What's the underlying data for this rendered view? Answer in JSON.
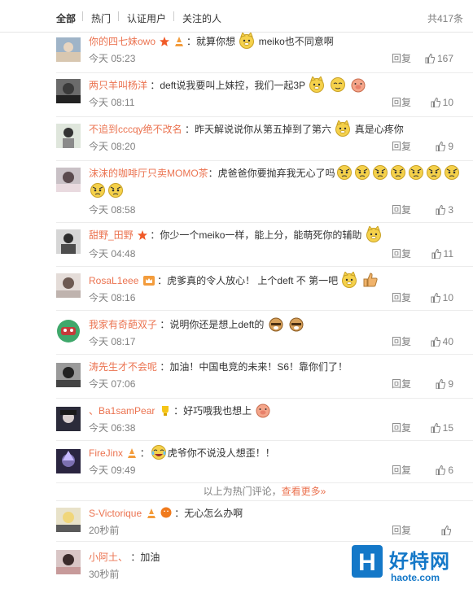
{
  "tabs": [
    {
      "label": "全部",
      "active": true
    },
    {
      "label": "热门",
      "active": false
    },
    {
      "label": "认证用户",
      "active": false
    },
    {
      "label": "关注的人",
      "active": false
    }
  ],
  "total": "共417条",
  "comments": [
    {
      "user": "你的四七妹owo",
      "text_a": "：就算你想",
      "text_b": "meiko也不同意啊",
      "time": "今天 05:23",
      "reply": "回复",
      "likes": "167"
    },
    {
      "user": "两只羊叫杨洋",
      "text_a": "：deft说我要叫上妹控，我们一起3P",
      "text_b": "",
      "time": "今天 08:11",
      "reply": "回复",
      "likes": "10"
    },
    {
      "user": "不追到cccqy绝不改名",
      "text_a": "：昨天解说说你从第五掉到了第六",
      "text_b": "真是心疼你",
      "time": "今天 08:20",
      "reply": "回复",
      "likes": "9"
    },
    {
      "user": "沫沫的咖啡厅只卖MOMO茶",
      "text_a": "：虎爸爸你要抛弃我无心了吗",
      "text_b": "",
      "time": "今天 08:58",
      "reply": "回复",
      "likes": "3"
    },
    {
      "user": "甜野_田野",
      "text_a": "：你少一个meiko一样，能上分，能萌死你的辅助",
      "text_b": "",
      "time": "今天 04:48",
      "reply": "回复",
      "likes": "11"
    },
    {
      "user": "RosaL1eee",
      "text_a": "：虎爹真的令人放心！ 上个deft 不 第一吧",
      "text_b": "",
      "time": "今天 08:16",
      "reply": "回复",
      "likes": "10"
    },
    {
      "user": "我家有奇葩双子",
      "text_a": "：说明你还是想上deft的",
      "text_b": "",
      "time": "今天 08:17",
      "reply": "回复",
      "likes": "40"
    },
    {
      "user": "涛先生才不会呢",
      "text_a": "：加油！中国电竞的未来！S6！靠你们了！",
      "text_b": "",
      "time": "今天 07:06",
      "reply": "回复",
      "likes": "9"
    },
    {
      "user": "、Ba1samPear",
      "text_a": "：好巧哦我也想上",
      "text_b": "",
      "time": "今天 06:38",
      "reply": "回复",
      "likes": "15"
    },
    {
      "user": "FireJinx",
      "text_a": "：",
      "text_b": "虎爷你不说没人想歪！！",
      "time": "今天 09:49",
      "reply": "回复",
      "likes": "6"
    }
  ],
  "hot_divider": {
    "text": "以上为热门评论，",
    "more": "查看更多»"
  },
  "recent": [
    {
      "user": "S-Victorique",
      "text_a": "：无心怎么办啊",
      "time": "20秒前",
      "reply": "回复"
    },
    {
      "user": "小阿土、",
      "text_a": "：加油",
      "time": "30秒前"
    }
  ],
  "watermark": {
    "title": "好特网",
    "url": "haote.com",
    "mark": "H"
  },
  "colors": {
    "username": "#eb7350",
    "muted": "#808080",
    "brand": "#1478c8"
  }
}
